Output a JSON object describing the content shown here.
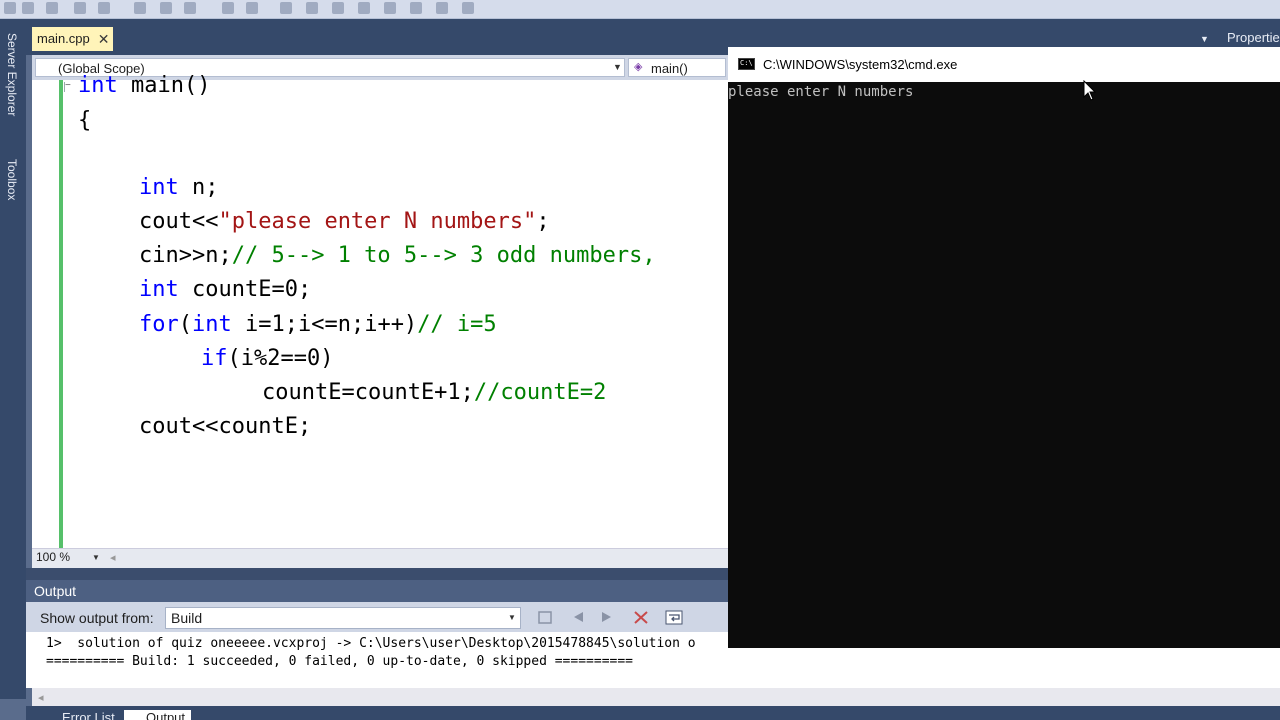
{
  "tabs": {
    "active_file": "main.cpp",
    "close_glyph": "✕",
    "properties_label": "Properties"
  },
  "side_tabs": {
    "server_explorer": "Server Explorer",
    "toolbox": "Toolbox"
  },
  "scope_bar": {
    "scope": "(Global Scope)",
    "function": "main()"
  },
  "code_lines": [
    {
      "segments": [
        {
          "t": "int",
          "c": "kw"
        },
        {
          "t": " main()",
          "c": ""
        }
      ]
    },
    {
      "segments": [
        {
          "t": "{",
          "c": ""
        }
      ]
    },
    {
      "segments": [
        {
          "t": "int",
          "c": "kw"
        },
        {
          "t": " n;",
          "c": ""
        }
      ]
    },
    {
      "segments": [
        {
          "t": "cout<<",
          "c": ""
        },
        {
          "t": "\"please enter N numbers\"",
          "c": "str"
        },
        {
          "t": ";",
          "c": ""
        }
      ]
    },
    {
      "segments": [
        {
          "t": "cin>>n;",
          "c": ""
        },
        {
          "t": "// 5--> 1 to 5--> 3 odd numbers,",
          "c": "cm"
        }
      ]
    },
    {
      "segments": [
        {
          "t": "int",
          "c": "kw"
        },
        {
          "t": " countE=0;",
          "c": ""
        }
      ]
    },
    {
      "segments": [
        {
          "t": "for",
          "c": "kw"
        },
        {
          "t": "(",
          "c": ""
        },
        {
          "t": "int",
          "c": "kw"
        },
        {
          "t": " i=1;i<=n;i++)",
          "c": ""
        },
        {
          "t": "// i=5",
          "c": "cm"
        }
      ]
    },
    {
      "segments": [
        {
          "t": "if",
          "c": "kw"
        },
        {
          "t": "(i%2==0)",
          "c": ""
        }
      ]
    },
    {
      "segments": [
        {
          "t": "countE=countE+1;",
          "c": ""
        },
        {
          "t": "//countE=2",
          "c": "cm"
        }
      ]
    },
    {
      "segments": [
        {
          "t": "cout<<countE;",
          "c": ""
        }
      ]
    }
  ],
  "zoom": {
    "level": "100 %"
  },
  "output": {
    "title": "Output",
    "show_from_label": "Show output from:",
    "show_from_value": "Build",
    "lines": [
      "1>  solution of quiz oneeeee.vcxproj -> C:\\Users\\user\\Desktop\\2015478845\\solution o",
      "========== Build: 1 succeeded, 0 failed, 0 up-to-date, 0 skipped =========="
    ]
  },
  "bottom_tabs": {
    "error_list": "Error List",
    "output": "Output"
  },
  "console": {
    "title": "C:\\WINDOWS\\system32\\cmd.exe",
    "text": "please enter N numbers"
  },
  "icons": {
    "close": "close-icon",
    "dropdown": "chevron-down-icon",
    "function": "method-icon",
    "console": "console-icon",
    "cursor": "mouse-pointer-icon"
  },
  "colors": {
    "keyword": "#0000ff",
    "string": "#a31515",
    "comment": "#008000",
    "active_tab": "#fff4b9",
    "ide_frame": "#35496a"
  }
}
